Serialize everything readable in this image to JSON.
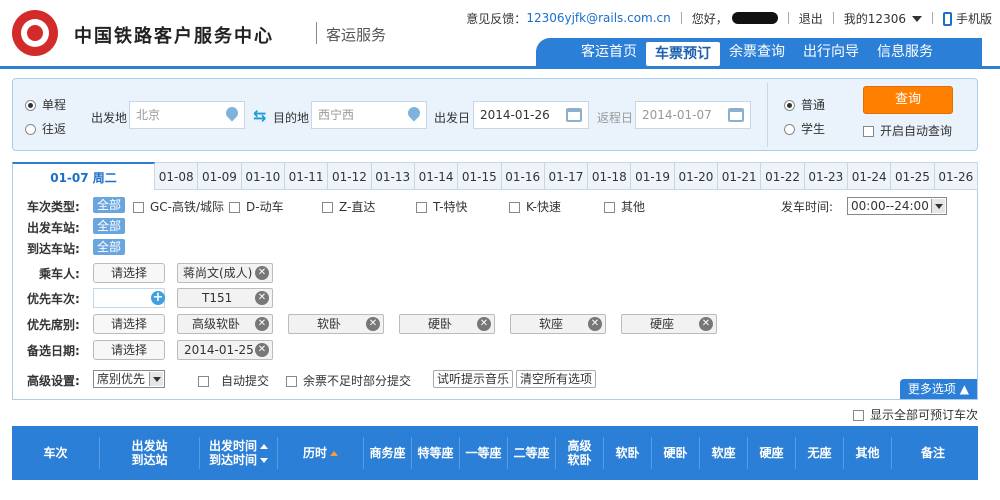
{
  "header": {
    "logo_text": "中国铁路客户服务中心",
    "logo_sub": "客运服务",
    "feedback_label": "意见反馈：",
    "feedback_email": "12306yjfk@rails.com.cn",
    "greeting": "您好，",
    "logout": "退出",
    "my_account": "我的12306",
    "mobile": "手机版"
  },
  "nav": {
    "items": [
      "客运首页",
      "车票预订",
      "余票查询",
      "出行向导",
      "信息服务"
    ],
    "active_index": 1
  },
  "search": {
    "trip_single": "单程",
    "trip_round": "往返",
    "from_label": "出发地",
    "from_value": "北京",
    "to_label": "目的地",
    "to_value": "西宁西",
    "depart_label": "出发日",
    "depart_value": "2014-01-26",
    "return_label": "返程日",
    "return_value": "2014-01-07",
    "ticket_normal": "普通",
    "ticket_student": "学生",
    "query_button": "查询",
    "auto_query": "开启自动查询"
  },
  "date_tabs": {
    "active": "01-07 周二",
    "dates": [
      "01-08",
      "01-09",
      "01-10",
      "01-11",
      "01-12",
      "01-13",
      "01-14",
      "01-15",
      "01-16",
      "01-17",
      "01-18",
      "01-19",
      "01-20",
      "01-21",
      "01-22",
      "01-23",
      "01-24",
      "01-25",
      "01-26"
    ]
  },
  "filters": {
    "train_type_label": "车次类型:",
    "all": "全部",
    "train_types": [
      "GC-高铁/城际",
      "D-动车",
      "Z-直达",
      "T-特快",
      "K-快速",
      "其他"
    ],
    "depart_time_label": "发车时间:",
    "depart_time_value": "00:00--24:00",
    "depart_station_label": "出发车站:",
    "arrive_station_label": "到达车站:",
    "passenger_label": "乘车人:",
    "select_button": "请选择",
    "passenger_tag": "蒋尚文(成人)",
    "priority_train_label": "优先车次:",
    "priority_train_tag": "T151",
    "priority_seat_label": "优先席别:",
    "seat_tags": [
      "高级软卧",
      "软卧",
      "硬卧",
      "软座",
      "硬座"
    ],
    "backup_date_label": "备选日期:",
    "backup_date_tag": "2014-01-25",
    "advanced_label": "高级设置:",
    "seat_priority_select": "席别优先",
    "auto_submit": "自动提交",
    "partial_submit": "余票不足时部分提交",
    "listen_music": "试听提示音乐",
    "clear_all": "清空所有选项",
    "more_options": "更多选项"
  },
  "results": {
    "show_all": "显示全部可预订车次",
    "columns": {
      "train": "车次",
      "station_from": "出发站",
      "station_to": "到达站",
      "time_from": "出发时间",
      "time_to": "到达时间",
      "duration": "历时",
      "business": "商务座",
      "special": "特等座",
      "first": "一等座",
      "second": "二等座",
      "senior_soft_sleeper_1": "高级",
      "senior_soft_sleeper_2": "软卧",
      "soft_sleeper": "软卧",
      "hard_sleeper": "硬卧",
      "soft_seat": "软座",
      "hard_seat": "硬座",
      "no_seat": "无座",
      "other": "其他",
      "remark": "备注"
    }
  }
}
